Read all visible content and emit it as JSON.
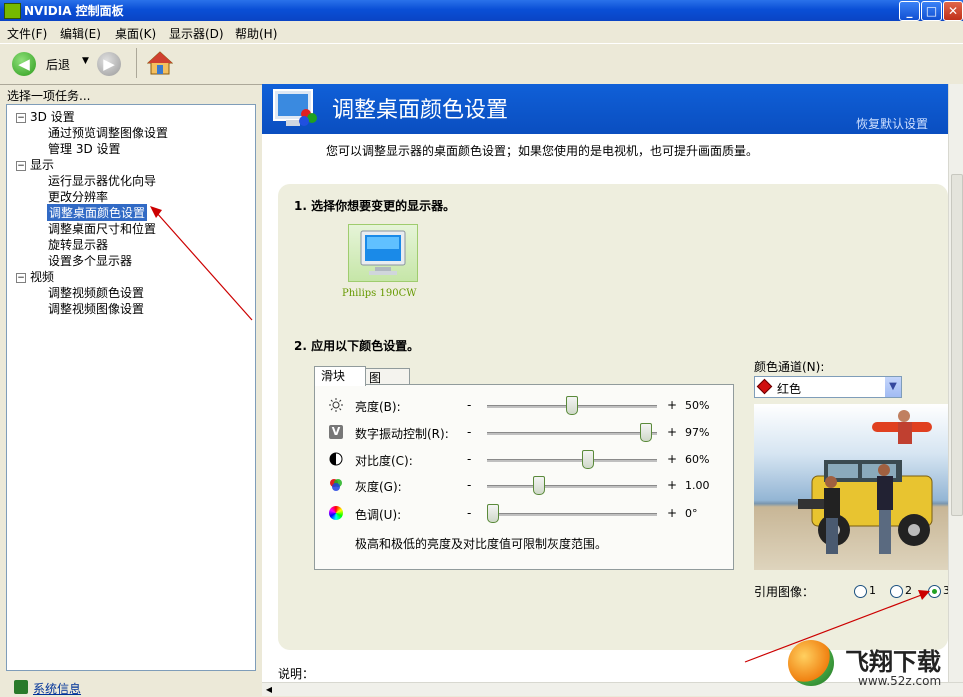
{
  "window": {
    "title": "NVIDIA 控制面板"
  },
  "menu": [
    "文件(F)",
    "编辑(E)",
    "桌面(K)",
    "显示器(D)",
    "帮助(H)"
  ],
  "toolbar": {
    "back_label": "后退"
  },
  "left": {
    "task_header": "选择一项任务...",
    "tree": [
      {
        "label": "3D 设置",
        "level": 0
      },
      {
        "label": "通过预览调整图像设置",
        "level": 1
      },
      {
        "label": "管理 3D 设置",
        "level": 1
      },
      {
        "label": "显示",
        "level": 0
      },
      {
        "label": "运行显示器优化向导",
        "level": 1
      },
      {
        "label": "更改分辨率",
        "level": 1
      },
      {
        "label": "调整桌面颜色设置",
        "level": 1,
        "selected": true
      },
      {
        "label": "调整桌面尺寸和位置",
        "level": 1
      },
      {
        "label": "旋转显示器",
        "level": 1
      },
      {
        "label": "设置多个显示器",
        "level": 1
      },
      {
        "label": "视频",
        "level": 0
      },
      {
        "label": "调整视频颜色设置",
        "level": 1
      },
      {
        "label": "调整视频图像设置",
        "level": 1
      }
    ],
    "sysinfo": "系统信息"
  },
  "main": {
    "title": "调整桌面颜色设置",
    "restore_default": "恢复默认设置",
    "description": "您可以调整显示器的桌面颜色设置；如果您使用的是电视机，也可提升画面质量。",
    "step1": "1. 选择你想要变更的显示器。",
    "monitor_name": "Philips 190CW",
    "step2": "2. 应用以下颜色设置。",
    "tabs": [
      "滑块",
      "图"
    ],
    "sliders": [
      {
        "label": "亮度(B):",
        "value": "50%",
        "pos": 0.5,
        "icon": "sun-icon"
      },
      {
        "label": "数字振动控制(R):",
        "value": "97%",
        "pos": 0.97,
        "icon": "vibrance-icon"
      },
      {
        "label": "对比度(C):",
        "value": "60%",
        "pos": 0.6,
        "icon": "contrast-icon"
      },
      {
        "label": "灰度(G):",
        "value": "1.00",
        "pos": 0.29,
        "icon": "gamma-icon"
      },
      {
        "label": "色调(U):",
        "value": "0°",
        "pos": 0.0,
        "icon": "hue-icon"
      }
    ],
    "minus": "-",
    "plus": "+",
    "note": "极高和极低的亮度及对比度值可限制灰度范围。",
    "channel_label": "颜色通道(N):",
    "channel_value": "红色",
    "reference_label": "引用图像：",
    "reference_options": [
      "1",
      "2",
      "3"
    ],
    "reference_selected": "3",
    "explain_label": "说明："
  },
  "watermark": {
    "brand": "飞翔下载",
    "url": "www.52z.com"
  },
  "colors": {
    "accent": "#0a4ec0",
    "nvidia_green": "#76b900",
    "selection": "#316ac5",
    "annotation": "#cc0000"
  }
}
